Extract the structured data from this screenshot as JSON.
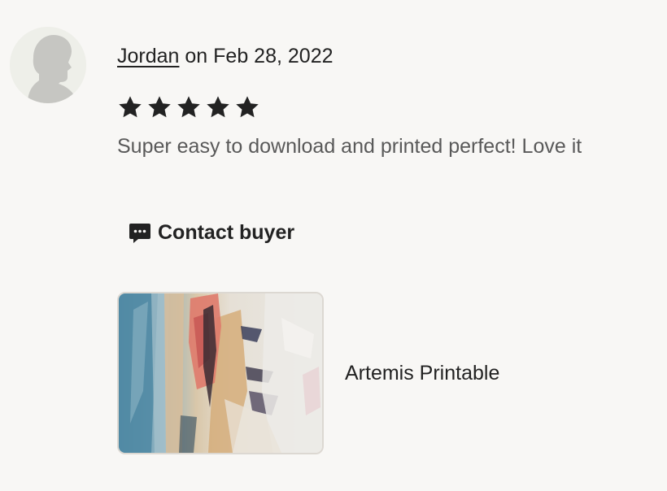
{
  "review": {
    "author": "Jordan",
    "date_text": "on Feb 28, 2022",
    "rating": 5,
    "rating_max": 5,
    "text": "Super easy to download and printed perfect! Love it",
    "avatar_icon": "default-user-silhouette-icon",
    "star_icon": "star-icon",
    "star_color": "#222222"
  },
  "contact": {
    "label": "Contact buyer",
    "icon": "message-dots-icon"
  },
  "listing": {
    "title": "Artemis Printable",
    "image": "abstract-painting-thumbnail"
  },
  "colors": {
    "background": "#f8f7f5",
    "text_primary": "#222222",
    "text_secondary": "#595959"
  }
}
